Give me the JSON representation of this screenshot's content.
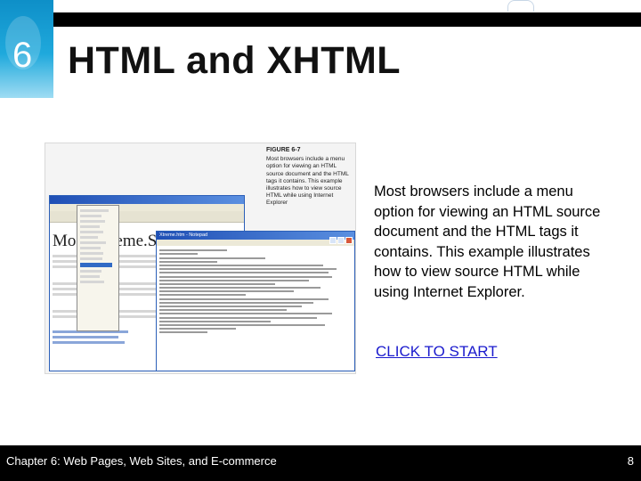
{
  "slide": {
    "chapter_number": "6",
    "title": "HTML and XHTML",
    "description": "Most browsers include a menu option for viewing an HTML source document and the HTML tags it contains. This example illustrates how to view source HTML while using Internet Explorer.",
    "start_link": "CLICK TO START"
  },
  "figure": {
    "label": "FIGURE 6-7",
    "caption": "Most browsers include a menu option for viewing an HTML source document and the HTML tags it contains. This example illustrates how to view source HTML while using Internet Explorer",
    "ie_heading": "Mo",
    "ie_heading_right": "eme.Sp",
    "notepad_title": "Xtreme.htm - Notepad"
  },
  "footer": {
    "chapter_text": "Chapter 6: Web Pages, Web Sites, and E-commerce",
    "page_number": "8"
  },
  "colors": {
    "accent_blue": "#1fa9dc",
    "footer_bg": "#000000",
    "link": "#1a1acd"
  }
}
